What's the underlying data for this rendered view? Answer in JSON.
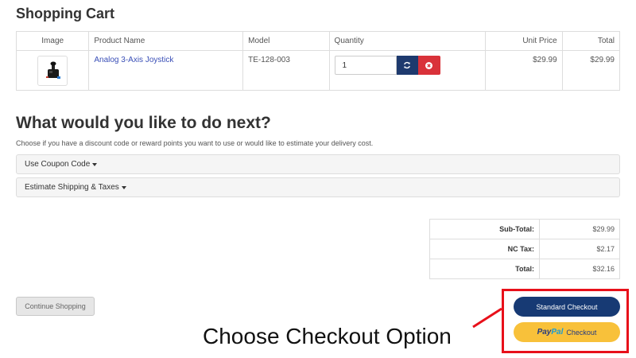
{
  "page_title": "Shopping Cart",
  "cart_table": {
    "headers": [
      "Image",
      "Product Name",
      "Model",
      "Quantity",
      "Unit Price",
      "Total"
    ],
    "rows": [
      {
        "image_icon": "joystick-product-icon",
        "product_name": "Analog 3-Axis Joystick",
        "model": "TE-128-003",
        "quantity": "1",
        "unit_price": "$29.99",
        "total": "$29.99"
      }
    ]
  },
  "next_section": {
    "heading": "What would you like to do next?",
    "description": "Choose if you have a discount code or reward points you want to use or would like to estimate your delivery cost.",
    "panels": [
      "Use Coupon Code",
      "Estimate Shipping & Taxes"
    ]
  },
  "totals": [
    {
      "label": "Sub-Total:",
      "value": "$29.99"
    },
    {
      "label": "NC Tax:",
      "value": "$2.17"
    },
    {
      "label": "Total:",
      "value": "$32.16"
    }
  ],
  "buttons": {
    "continue_shopping": "Continue Shopping",
    "standard_checkout": "Standard Checkout",
    "paypal_pay": "Pay",
    "paypal_pal": "Pal",
    "paypal_checkout": "Checkout"
  },
  "annotation": {
    "text": "Choose Checkout Option",
    "color": "#e8101a"
  },
  "colors": {
    "primary_navy": "#173a74",
    "danger_red": "#d9323a",
    "paypal_yellow": "#f8c13a",
    "link_blue": "#3a4fb7"
  }
}
